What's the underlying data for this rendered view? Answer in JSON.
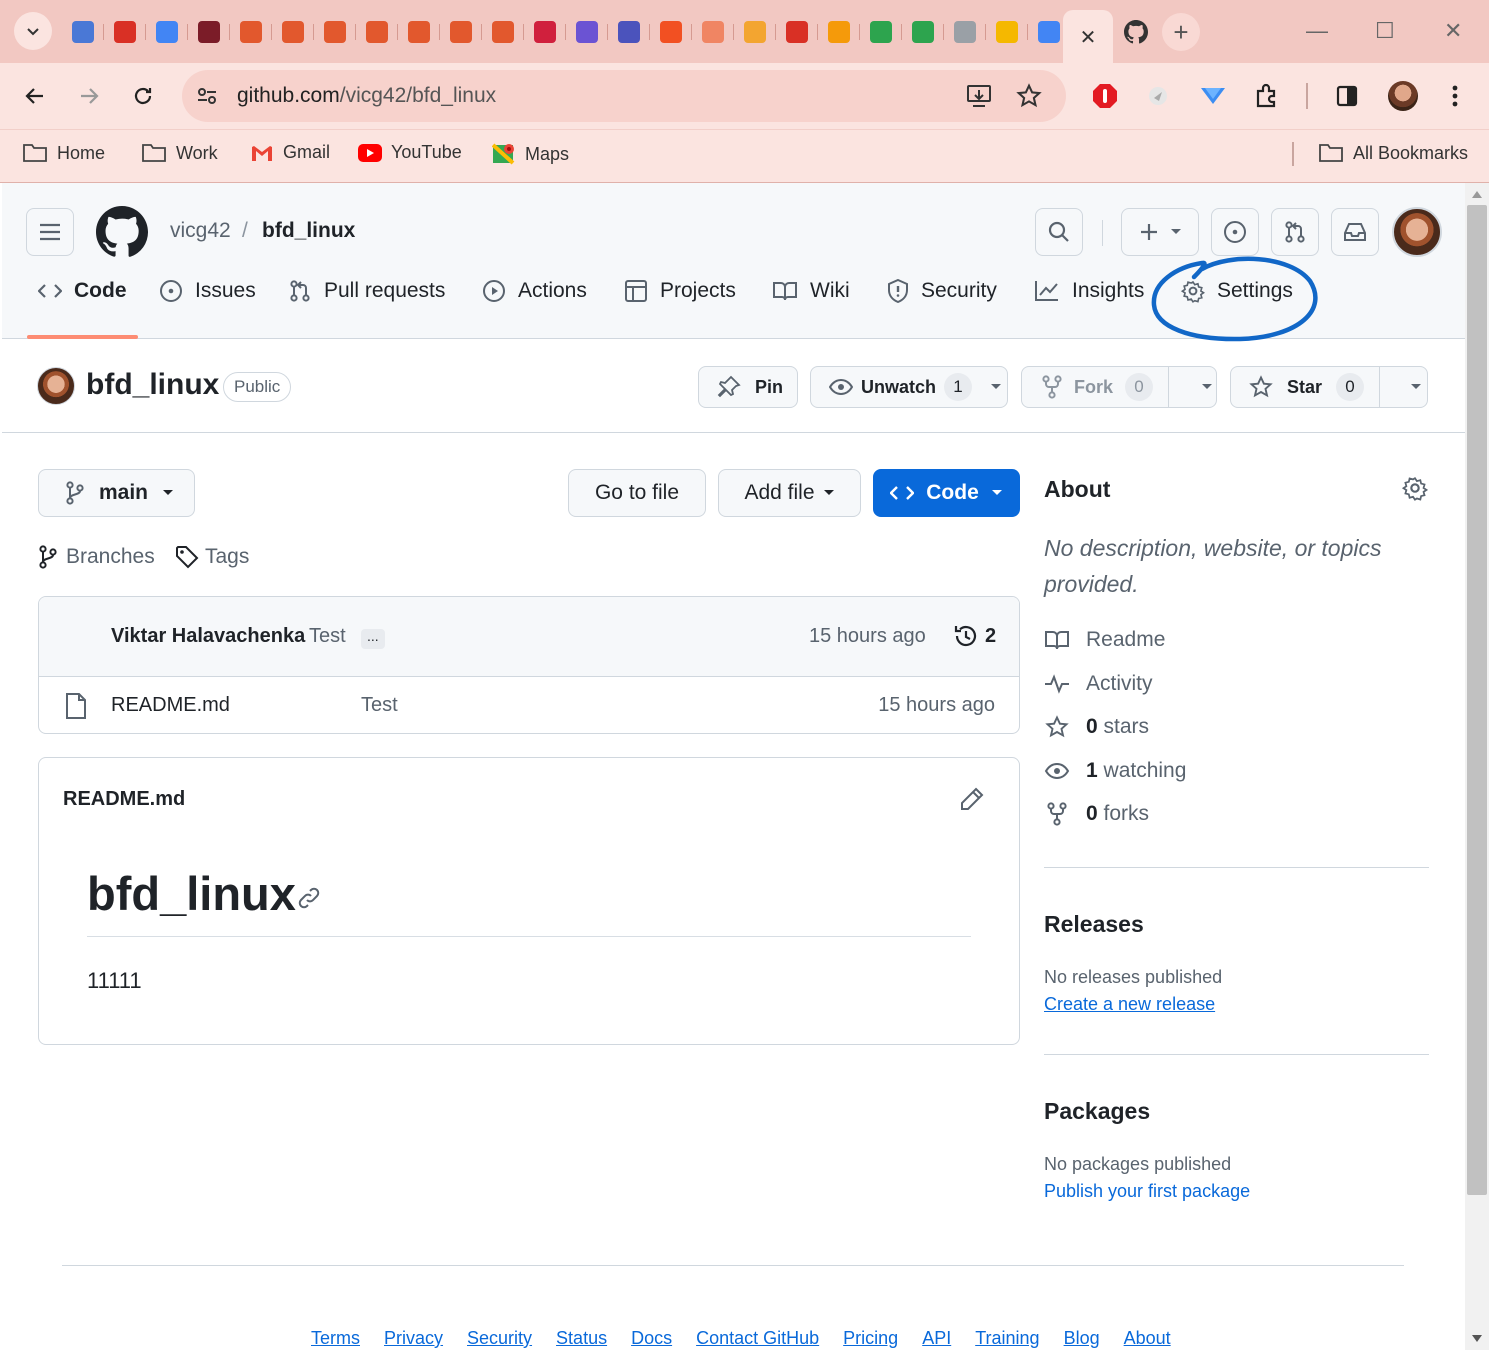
{
  "browser": {
    "url_host": "github.com",
    "url_path": "/vicg42/bfd_linux",
    "active_tab_close": "✕",
    "new_tab": "+",
    "bookmarks": [
      {
        "label": "Home",
        "icon": "folder-icon"
      },
      {
        "label": "Work",
        "icon": "folder-icon"
      },
      {
        "label": "Gmail",
        "icon": "gmail-icon"
      },
      {
        "label": "YouTube",
        "icon": "youtube-icon"
      },
      {
        "label": "Maps",
        "icon": "maps-icon"
      }
    ],
    "all_bookmarks": "All Bookmarks",
    "tab_favicon_colors": [
      "#4a78d6",
      "#d93025",
      "#4285f4",
      "#7b1c28",
      "#e2582d",
      "#e2582d",
      "#e2582d",
      "#e2582d",
      "#e2582d",
      "#e2582d",
      "#e2582d",
      "#d0203d",
      "#6b53d3",
      "#4b53bc",
      "#f25022",
      "#f08563",
      "#f3a530",
      "#d93025",
      "#f59a0a",
      "#2da44e",
      "#2da44e",
      "#9aa0a6",
      "#f5b800",
      "#4285f4"
    ]
  },
  "repo": {
    "owner": "vicg42",
    "separator": "/",
    "name": "bfd_linux",
    "visibility": "Public"
  },
  "nav": {
    "code": "Code",
    "issues": "Issues",
    "pull_requests": "Pull requests",
    "actions": "Actions",
    "projects": "Projects",
    "wiki": "Wiki",
    "security": "Security",
    "insights": "Insights",
    "settings": "Settings"
  },
  "actions": {
    "pin": "Pin",
    "unwatch": "Unwatch",
    "watch_count": "1",
    "fork": "Fork",
    "fork_count": "0",
    "star": "Star",
    "star_count": "0"
  },
  "toolbar": {
    "branch": "main",
    "branches": "Branches",
    "tags": "Tags",
    "go_to_file": "Go to file",
    "add_file": "Add file",
    "code": "Code"
  },
  "commit": {
    "author": "Viktar Halavachenka",
    "message": "Test",
    "ellipsis": "...",
    "time": "15 hours ago",
    "count": "2"
  },
  "files": [
    {
      "name": "README.md",
      "message": "Test",
      "time": "15 hours ago"
    }
  ],
  "readme": {
    "filename": "README.md",
    "heading": "bfd_linux",
    "body": "11111"
  },
  "about": {
    "title": "About",
    "description": "No description, website, or topics provided.",
    "readme": "Readme",
    "activity": "Activity",
    "stars_count": "0",
    "stars_label": "stars",
    "watching_count": "1",
    "watching_label": "watching",
    "forks_count": "0",
    "forks_label": "forks"
  },
  "releases": {
    "title": "Releases",
    "empty": "No releases published",
    "link": "Create a new release"
  },
  "packages": {
    "title": "Packages",
    "empty": "No packages published",
    "link": "Publish your first package"
  },
  "footer": [
    "Terms",
    "Privacy",
    "Security",
    "Status",
    "Docs",
    "Contact GitHub",
    "Pricing",
    "API",
    "Training",
    "Blog",
    "About"
  ]
}
